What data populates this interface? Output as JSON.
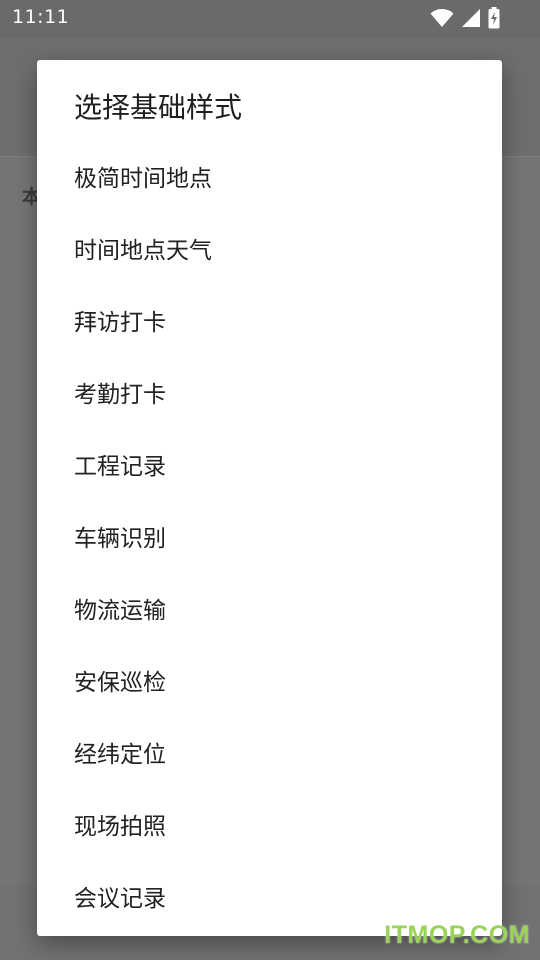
{
  "status_bar": {
    "time": "11:11",
    "icons": [
      "wifi-icon",
      "cellular-signal-icon",
      "battery-charging-icon"
    ]
  },
  "background_app": {
    "partial_text": "本"
  },
  "dialog": {
    "title": "选择基础样式",
    "options": [
      {
        "label": "极简时间地点"
      },
      {
        "label": "时间地点天气"
      },
      {
        "label": "拜访打卡"
      },
      {
        "label": "考勤打卡"
      },
      {
        "label": "工程记录"
      },
      {
        "label": "车辆识别"
      },
      {
        "label": "物流运输"
      },
      {
        "label": "安保巡检"
      },
      {
        "label": "经纬定位"
      },
      {
        "label": "现场拍照"
      },
      {
        "label": "会议记录"
      }
    ]
  },
  "watermark": {
    "text": "ITMOP.COM"
  },
  "colors": {
    "scrim": "#6b6b6b",
    "dialog_bg": "#ffffff",
    "text_primary": "#222222",
    "watermark": "#9bd35a"
  }
}
